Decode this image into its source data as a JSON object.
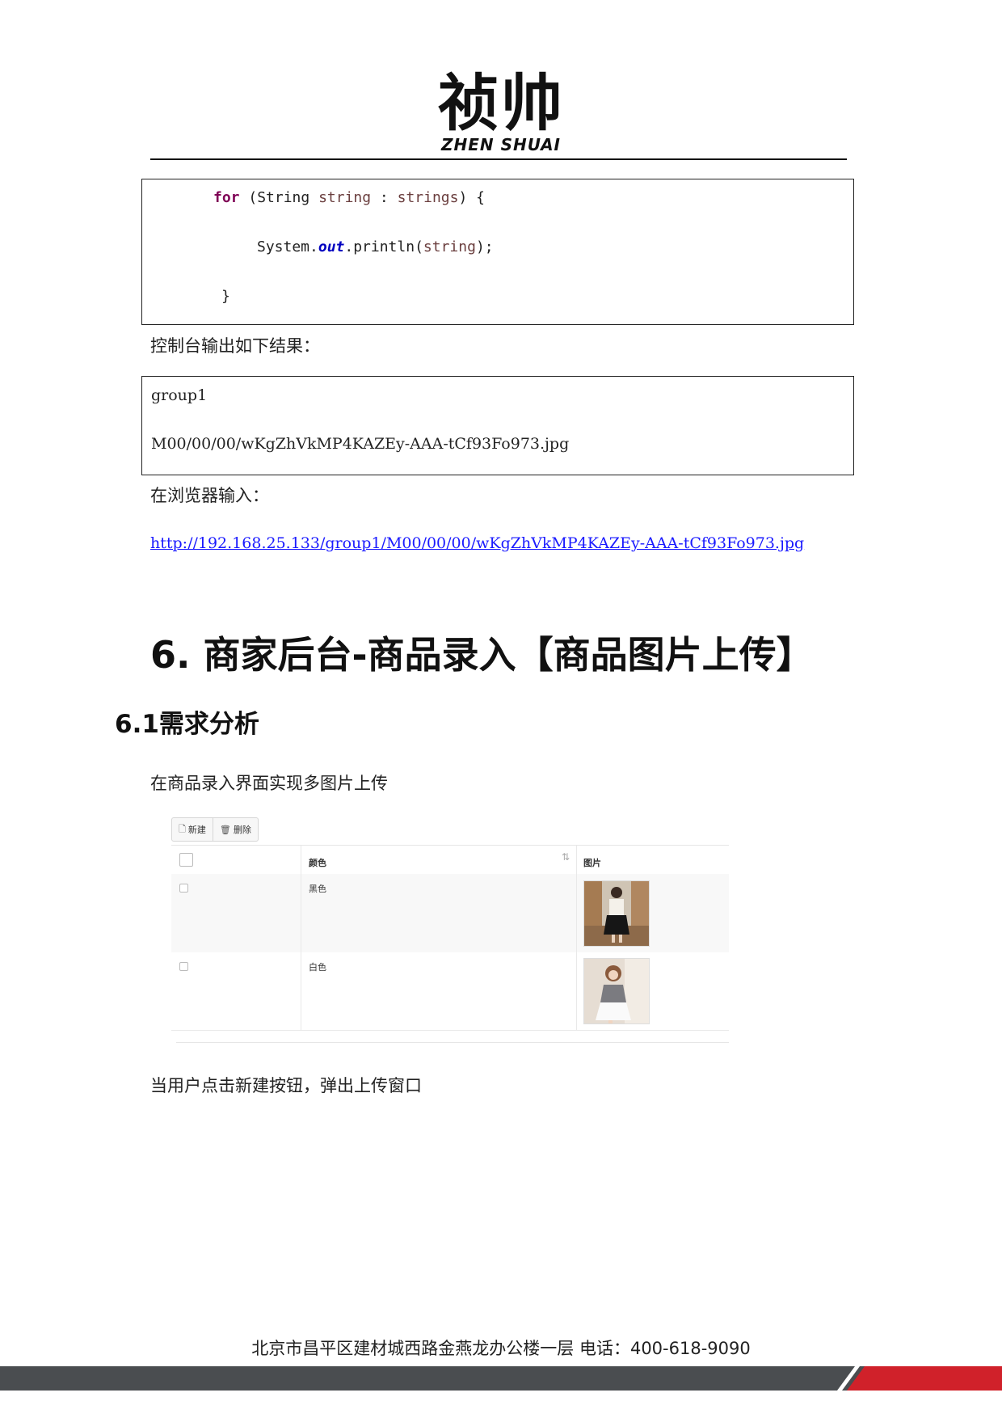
{
  "header": {
    "logo_text": "祯帅",
    "logo_subtext": "ZHEN SHUAI"
  },
  "code": {
    "line1": {
      "kw": "for",
      "p1": " (String ",
      "var1": "string",
      "p2": " : ",
      "var2": "strings",
      "p3": ") {"
    },
    "line2": {
      "p1": "System.",
      "field": "out",
      "p2": ".println(",
      "var": "string",
      "p3": ");"
    },
    "line3": "}"
  },
  "text": {
    "console_label": "控制台输出如下结果：",
    "browser_label": "在浏览器输入：",
    "url": "http://192.168.25.133/group1/M00/00/00/wKgZhVkMP4KAZEy-AAA-tCf93Fo973.jpg",
    "h1": "6. 商家后台-商品录入【商品图片上传】",
    "h2": "6.1需求分析",
    "desc": "在商品录入界面实现多图片上传",
    "after": "当用户点击新建按钮，弹出上传窗口"
  },
  "output": {
    "line1": "group1",
    "line2": "M00/00/00/wKgZhVkMP4KAZEy-AAA-tCf93Fo973.jpg"
  },
  "screenshot": {
    "toolbar": {
      "new_label": "新建",
      "delete_label": "删除"
    },
    "columns": {
      "color": "颜色",
      "image": "图片"
    },
    "rows": [
      {
        "color": "黑色"
      },
      {
        "color": "白色"
      }
    ]
  },
  "footer": {
    "text": "北京市昌平区建材城西路金燕龙办公楼一层   电话：400-618-9090",
    "colors": {
      "dark": "#4a4d50",
      "accent": "#d0212a"
    }
  }
}
